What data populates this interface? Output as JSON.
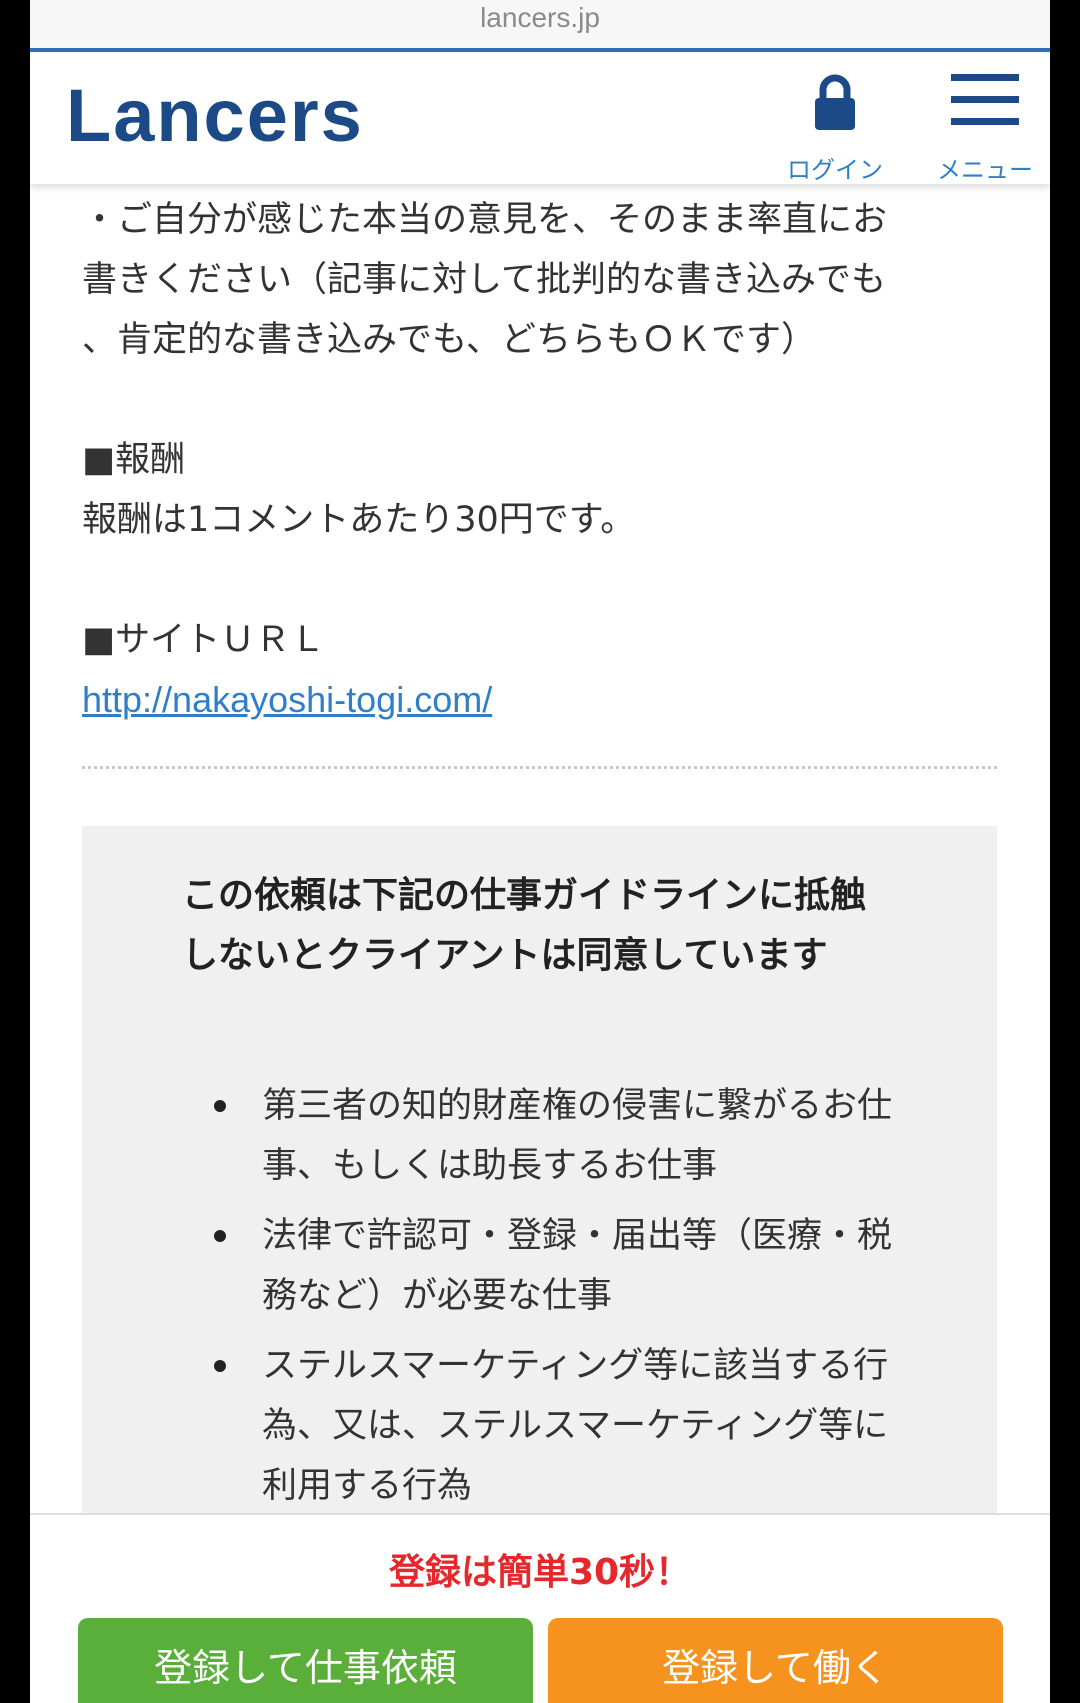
{
  "browser": {
    "url": "lancers.jp",
    "accent_color": "#2f6fb8"
  },
  "header": {
    "logo": "Lancers",
    "logo_color": "#1c4a86",
    "login": {
      "icon": "lock-icon",
      "label": "ログイン"
    },
    "menu": {
      "icon": "hamburger-icon",
      "label": "メニュー"
    }
  },
  "content": {
    "intro_paragraph": "・ご自分が感じた本当の意見を、そのまま率直にお\n書きください（記事に対して批判的な書き込みでも\n、肯定的な書き込みでも、どちらもＯＫです）",
    "reward_heading": "■報酬",
    "reward_text": "報酬は1コメントあたり30円です。",
    "site_heading": "■サイトＵＲＬ",
    "site_url": "http://nakayoshi-togi.com/"
  },
  "guideline": {
    "title": "この依頼は下記の仕事ガイドラインに抵触しないとクライアントは同意しています",
    "items": [
      "第三者の知的財産権の侵害に繋がるお仕事、もしくは助長するお仕事",
      "法律で許認可・登録・届出等（医療・税務など）が必要な仕事",
      "ステルスマーケティング等に該当する行為、又は、ステルスマーケティング等に利用する行為"
    ]
  },
  "footer": {
    "note": "登録は簡単30秒！",
    "note_color": "#e4282b",
    "client_button": "登録して仕事依頼",
    "client_button_color": "#5aae3a",
    "worker_button": "登録して働く",
    "worker_button_color": "#f6931e"
  }
}
